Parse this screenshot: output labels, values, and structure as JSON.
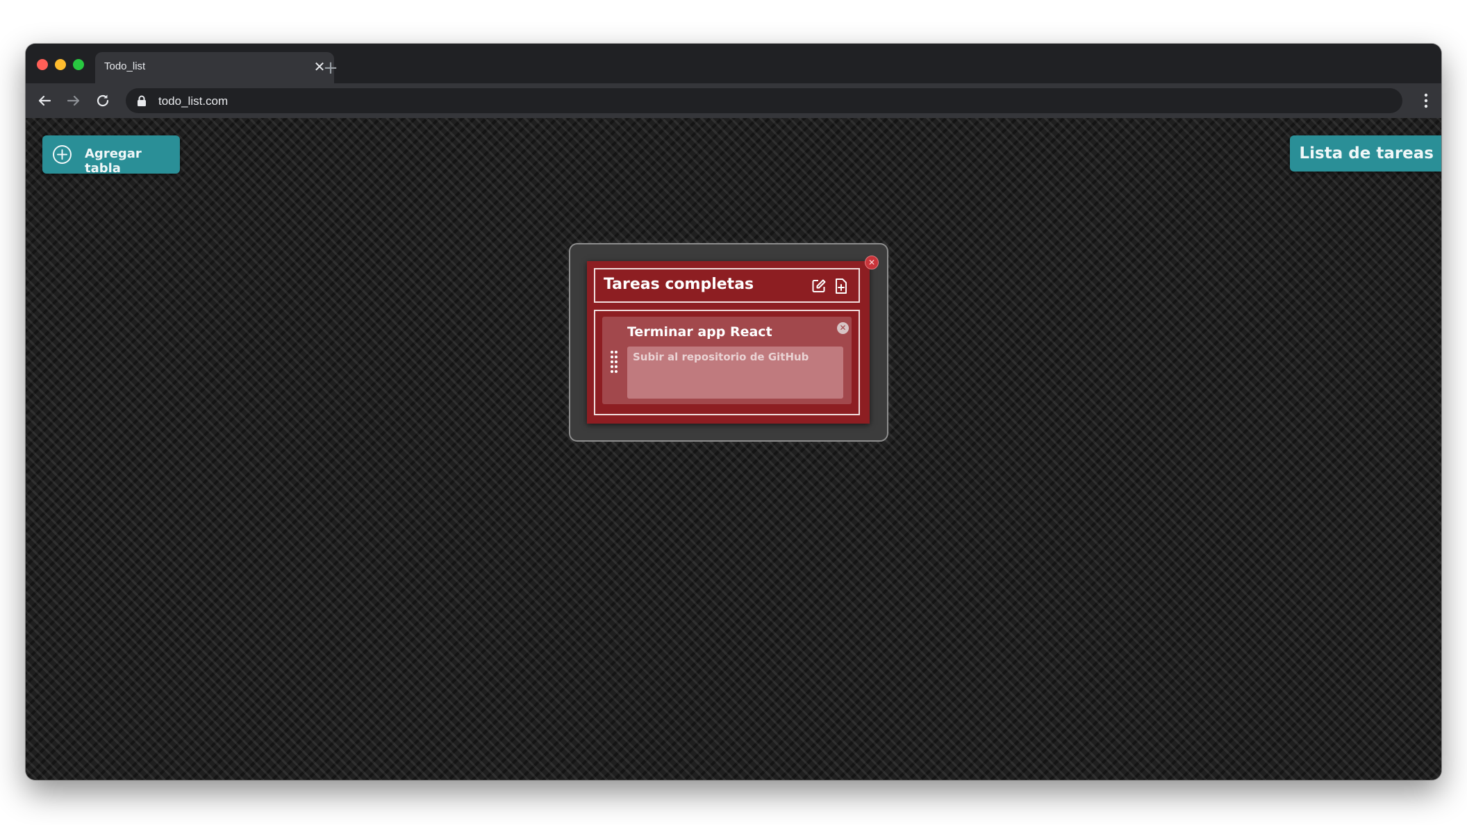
{
  "browser": {
    "tab_title": "Todo_list",
    "tab_close_glyph": "✕",
    "new_tab_glyph": "+",
    "url": "todo_list.com",
    "icons": [
      "back-arrow-icon",
      "forward-arrow-icon",
      "reload-icon",
      "lock-icon",
      "more-vert-icon"
    ]
  },
  "app": {
    "add_table_label": "Agregar tabla",
    "list_title": "Lista de tareas",
    "accent_color": "#2a8f97"
  },
  "board": {
    "title": "Tareas completas",
    "color": "#8d1e22",
    "close_glyph": "✕",
    "icons": [
      "edit-icon",
      "add-file-icon"
    ],
    "tasks": [
      {
        "title": "Terminar app React",
        "description": "Subir al repositorio de GitHub",
        "remove_glyph": "✕"
      }
    ]
  }
}
